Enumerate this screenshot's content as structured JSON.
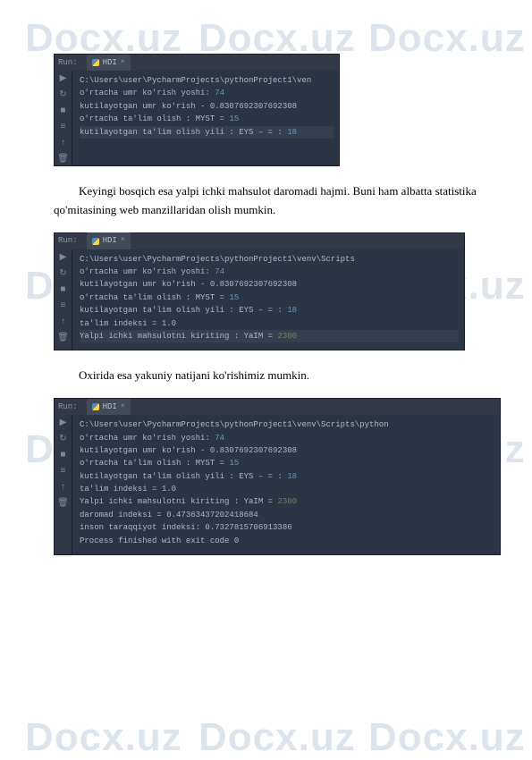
{
  "watermark": "Docx.uz",
  "ide": {
    "run_label": "Run:",
    "tab_label": "HDI",
    "tab_close": "×"
  },
  "block1": {
    "sidebar_icons": [
      "▶",
      "↻",
      "■",
      "≡",
      "↑",
      "🗑"
    ],
    "lines": {
      "l1": "C:\\Users\\user\\PycharmProjects\\pythonProject1\\ven",
      "l2a": "o'rtacha umr ko'rish yoshi: ",
      "l2b": "74",
      "l3": " kutilayotgan umr ko'rish  - 0.8307692307692308",
      "l4a": " o'rtacha ta'lim olish : MYST = ",
      "l4b": "15",
      "l5a": " kutilayotgan ta'lim olish yili : EYS – = : ",
      "l5b": "18"
    }
  },
  "para1": "Keyingi bosqich esa yalpi ichki mahsulot daromadi hajmi. Buni ham albatta statistika qo'mitasining web manzillaridan olish mumkin.",
  "block2": {
    "sidebar_icons": [
      "▶",
      "↻",
      "■",
      "≡",
      "↑",
      "🗑"
    ],
    "lines": {
      "l1": "C:\\Users\\user\\PycharmProjects\\pythonProject1\\venv\\Scripts",
      "l2a": "o'rtacha umr ko'rish yoshi: ",
      "l2b": "74",
      "l3": " kutilayotgan umr ko'rish  - 0.8307692307692308",
      "l4a": " o'rtacha ta'lim olish : MYST = ",
      "l4b": "15",
      "l5a": " kutilayotgan ta'lim olish yili : EYS – = : ",
      "l5b": "18",
      "l6": " ta'lim indeksi  =  1.0",
      "l7a": "Yalpi ichki mahsulotni kiriting : YaIM =  ",
      "l7b": "2300"
    }
  },
  "para2": "Oxirida esa yakuniy natijani ko'rishimiz mumkin.",
  "block3": {
    "sidebar_icons": [
      "▶",
      "↻",
      "■",
      "≡",
      "↑",
      "🗑"
    ],
    "lines": {
      "l1": "C:\\Users\\user\\PycharmProjects\\pythonProject1\\venv\\Scripts\\python",
      "l2a": "o'rtacha umr ko'rish yoshi: ",
      "l2b": "74",
      "l3": " kutilayotgan umr ko'rish  - 0.8307692307692308",
      "l4a": " o'rtacha ta'lim olish : MYST = ",
      "l4b": "15",
      "l5a": " kutilayotgan ta'lim olish yili : EYS – = : ",
      "l5b": "18",
      "l6": " ta'lim indeksi  =  1.0",
      "l7a": "Yalpi ichki mahsulotni kiriting : YaIM =  ",
      "l7b": "2300",
      "l8": " daromad indeksi  =  0.47363437202418684",
      "l9": " inson taraqqiyot indeksi:   0.7327815706913386",
      "l10": "",
      "l11": "Process finished with exit code 0"
    }
  }
}
